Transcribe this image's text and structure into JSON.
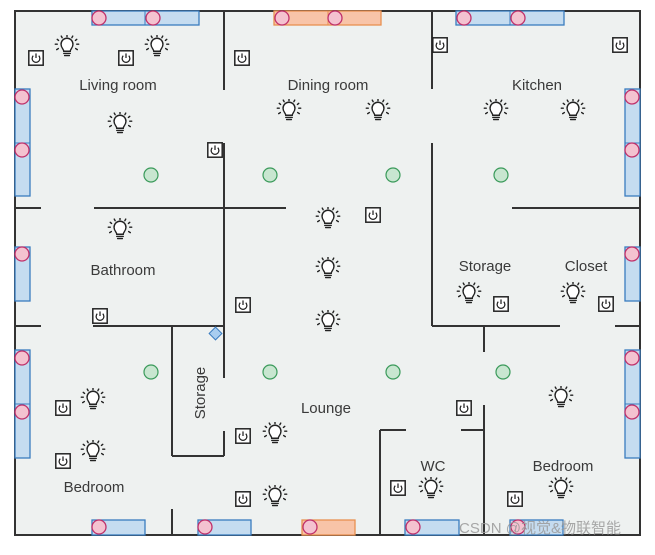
{
  "rooms": {
    "living_room": "Living room",
    "dining_room": "Dining room",
    "kitchen": "Kitchen",
    "bathroom": "Bathroom",
    "storage_right": "Storage",
    "closet": "Closet",
    "storage_left": "Storage",
    "lounge": "Lounge",
    "wc": "WC",
    "bedroom_left": "Bedroom",
    "bedroom_right": "Bedroom"
  },
  "watermark": "CSDN @视觉&物联智能",
  "icons": {
    "light": "light-bulb-icon",
    "switch": "power-switch-icon",
    "sensor": "green-sensor-dot",
    "window_sensor": "pink-window-sensor",
    "access_point": "blue-diamond-icon"
  },
  "colors": {
    "floor": "#eef1f0",
    "wall": "#333333",
    "window_fill": "#c5dcf0",
    "window_stroke": "#3a7cc0",
    "door_fill": "#f8c4a8",
    "door_stroke": "#e89050",
    "contact_fill": "#f4c2d0",
    "contact_stroke": "#c0306a",
    "sensor_fill": "#c8e6d0",
    "sensor_stroke": "#3a9a5a"
  }
}
